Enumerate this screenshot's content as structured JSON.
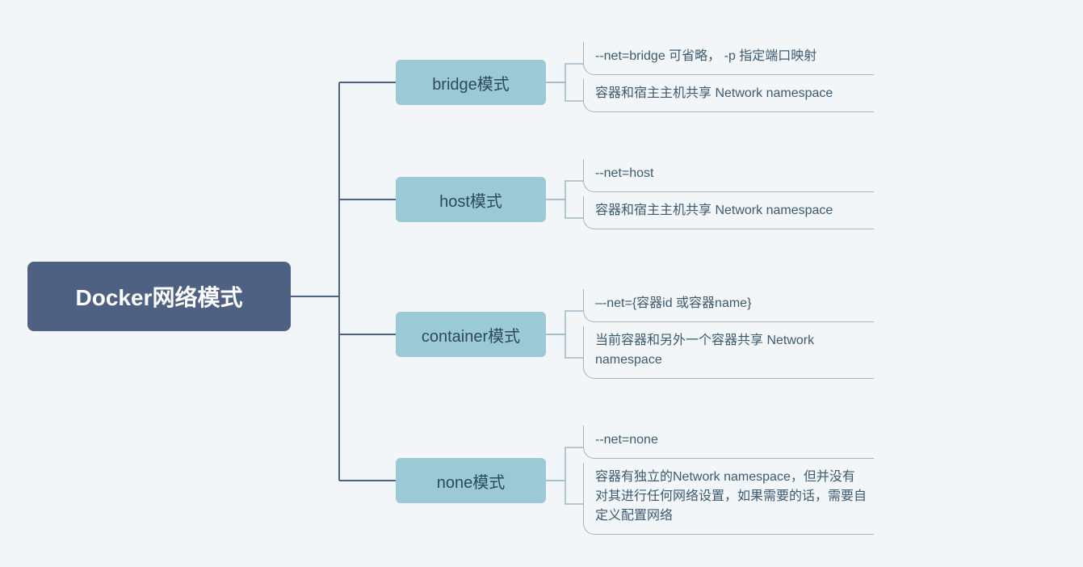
{
  "root": {
    "title": "Docker网络模式"
  },
  "branches": [
    {
      "label": "bridge模式",
      "leaves": [
        "--net=bridge   可省略， -p 指定端口映射",
        "容器和宿主主机共享 Network namespace"
      ]
    },
    {
      "label": "host模式",
      "leaves": [
        "--net=host",
        "容器和宿主主机共享 Network namespace"
      ]
    },
    {
      "label": "container模式",
      "leaves": [
        "–-net={容器id 或容器name}",
        "当前容器和另外一个容器共享 Network namespace"
      ]
    },
    {
      "label": "none模式",
      "leaves": [
        "--net=none",
        "容器有独立的Network namespace，但并没有对其进行任何网络设置，如果需要的话，需要自定义配置网络"
      ]
    }
  ]
}
